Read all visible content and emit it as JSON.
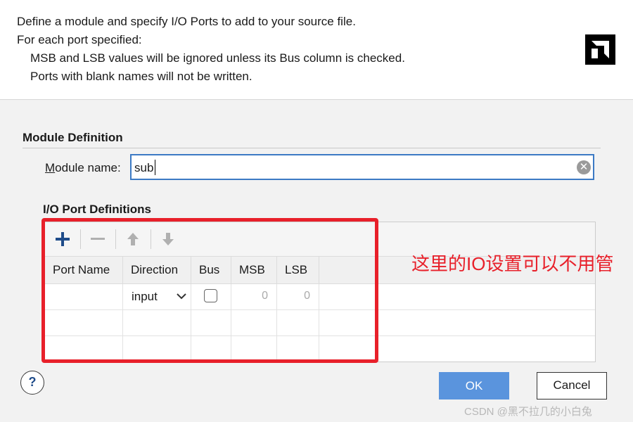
{
  "header": {
    "lines": [
      "Define a module and specify I/O Ports to add to your source file.",
      "For each port specified:",
      "MSB and LSB values will be ignored unless its Bus column is checked.",
      "Ports with blank names will not be written."
    ],
    "logo_icon": "amd-logo-icon"
  },
  "module_definition": {
    "title": "Module Definition",
    "name_label_prefix": "M",
    "name_label_rest": "odule name:",
    "name_value": "sub"
  },
  "io_ports": {
    "title": "I/O Port Definitions",
    "toolbar": {
      "add_icon": "plus-icon",
      "remove_icon": "minus-icon",
      "move_up_icon": "arrow-up-icon",
      "move_down_icon": "arrow-down-icon"
    },
    "columns": [
      "Port Name",
      "Direction",
      "Bus",
      "MSB",
      "LSB"
    ],
    "rows": [
      {
        "port_name": "",
        "direction": "input",
        "bus": false,
        "msb": "0",
        "lsb": "0"
      }
    ]
  },
  "annotation": "这里的IO设置可以不用管",
  "buttons": {
    "help": "?",
    "ok": "OK",
    "cancel": "Cancel"
  },
  "watermark": "CSDN @黑不拉几的小白兔",
  "colors": {
    "accent": "#5a94dd",
    "input_border": "#3c7ac4",
    "annotation_red": "#e8202a"
  }
}
